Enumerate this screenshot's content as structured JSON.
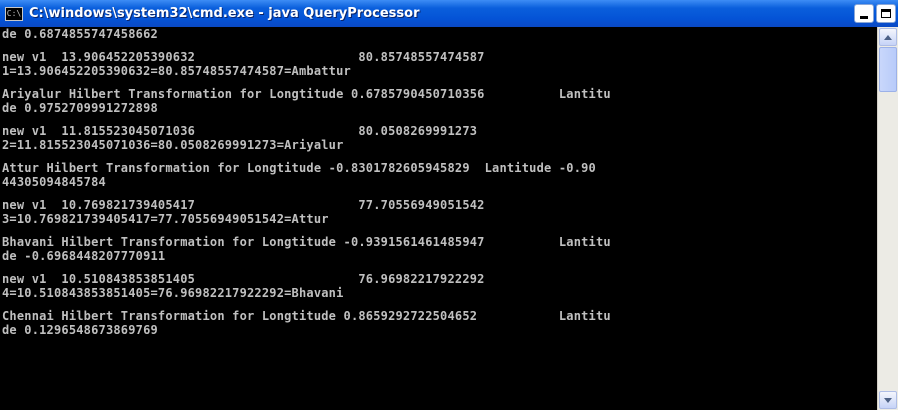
{
  "window": {
    "icon_text": "C:\\",
    "title": "C:\\windows\\system32\\cmd.exe - java QueryProcessor"
  },
  "console": {
    "lines": [
      "de 0.6874855747458662",
      "",
      "new v1  13.906452205390632                      80.85748557474587",
      "1=13.906452205390632=80.85748557474587=Ambattur",
      "",
      "Ariyalur Hilbert Transformation for Longtitude 0.6785790450710356          Lantitu",
      "de 0.9752709991272898",
      "",
      "new v1  11.815523045071036                      80.0508269991273",
      "2=11.815523045071036=80.0508269991273=Ariyalur",
      "",
      "Attur Hilbert Transformation for Longtitude -0.8301782605945829  Lantitude -0.90",
      "44305094845784",
      "",
      "new v1  10.769821739405417                      77.70556949051542",
      "3=10.769821739405417=77.70556949051542=Attur",
      "",
      "Bhavani Hilbert Transformation for Longtitude -0.9391561461485947          Lantitu",
      "de -0.6968448207770911",
      "",
      "new v1  10.510843853851405                      76.96982217922292",
      "4=10.510843853851405=76.96982217922292=Bhavani",
      "",
      "Chennai Hilbert Transformation for Longtitude 0.8659292722504652           Lantitu",
      "de 0.1296548673869769"
    ]
  }
}
